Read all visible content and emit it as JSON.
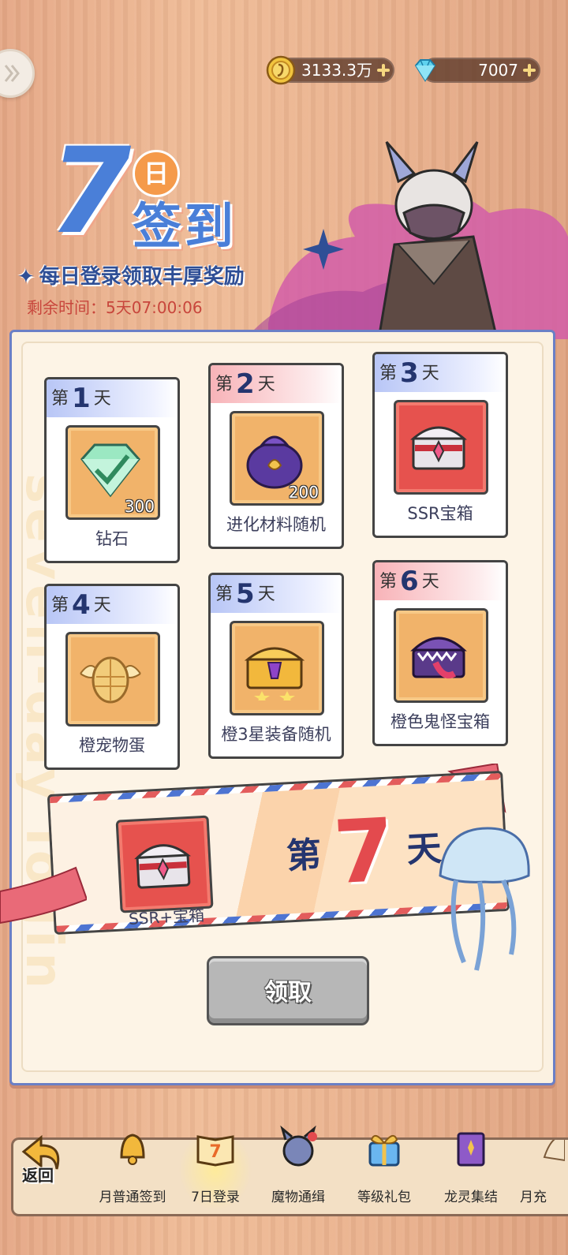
{
  "currency": {
    "gold": "3133.3万",
    "gems": "7007"
  },
  "title": {
    "number": "7",
    "ri": "日",
    "main": "签到",
    "subtitle": "每日登录领取丰厚奖励",
    "remaining": "剩余时间：5天07:00:06"
  },
  "watermark": "seven-day login",
  "days": [
    {
      "prefix": "第",
      "num": "1",
      "suffix": "天",
      "item": "钻石",
      "count": "300",
      "icon": "diamond-icon"
    },
    {
      "prefix": "第",
      "num": "2",
      "suffix": "天",
      "item": "进化材料随机",
      "count": "200",
      "icon": "dragon-bag-icon"
    },
    {
      "prefix": "第",
      "num": "3",
      "suffix": "天",
      "item": "SSR宝箱",
      "count": "",
      "icon": "ssr-chest-icon"
    },
    {
      "prefix": "第",
      "num": "4",
      "suffix": "天",
      "item": "橙宠物蛋",
      "count": "",
      "icon": "winged-egg-icon"
    },
    {
      "prefix": "第",
      "num": "5",
      "suffix": "天",
      "item": "橙3星装备随机",
      "count": "",
      "icon": "gold-chest-icon"
    },
    {
      "prefix": "第",
      "num": "6",
      "suffix": "天",
      "item": "橙色鬼怪宝箱",
      "count": "",
      "icon": "monster-chest-icon"
    }
  ],
  "day7": {
    "prefix": "第",
    "num": "7",
    "suffix": "天",
    "item": "SSR+宝箱",
    "icon": "ssr-plus-chest-icon"
  },
  "claim_button": "领取",
  "bottom_nav": {
    "back": "返回",
    "tabs": [
      "月普通签到",
      "7日登录",
      "魔物通缉",
      "等级礼包",
      "龙灵集结",
      "月充"
    ]
  },
  "colors": {
    "accent_blue": "#4a7fd8",
    "day_red": "#e34a4e",
    "remaining_red": "#c8463c"
  }
}
